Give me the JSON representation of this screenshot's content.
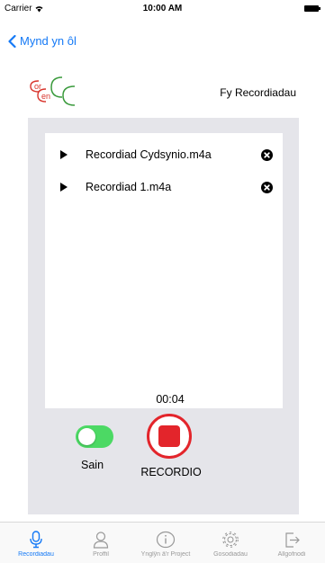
{
  "status_bar": {
    "carrier": "Carrier",
    "time": "10:00 AM"
  },
  "nav": {
    "back_label": "Mynd yn ôl"
  },
  "header": {
    "logo_text": "Cor en CC",
    "title": "Fy Recordiadau"
  },
  "recordings": [
    {
      "name": "Recordiad Cydsynio.m4a"
    },
    {
      "name": "Recordiad 1.m4a"
    }
  ],
  "recorder": {
    "timer": "00:04",
    "sound_label": "Sain",
    "sound_on": true,
    "record_label": "RECORDIO"
  },
  "tabs": [
    {
      "label": "Recordiadau",
      "icon": "microphone-icon",
      "active": true
    },
    {
      "label": "Proffil",
      "icon": "person-icon",
      "active": false
    },
    {
      "label": "Ynglŷn â'r Project",
      "icon": "info-icon",
      "active": false
    },
    {
      "label": "Gosodiadau",
      "icon": "gear-icon",
      "active": false
    },
    {
      "label": "Allgofnodi",
      "icon": "logout-icon",
      "active": false
    }
  ],
  "colors": {
    "accent": "#1479f6",
    "record": "#e3252b",
    "toggle_on": "#4cd964",
    "panel": "#e5e5ea"
  }
}
